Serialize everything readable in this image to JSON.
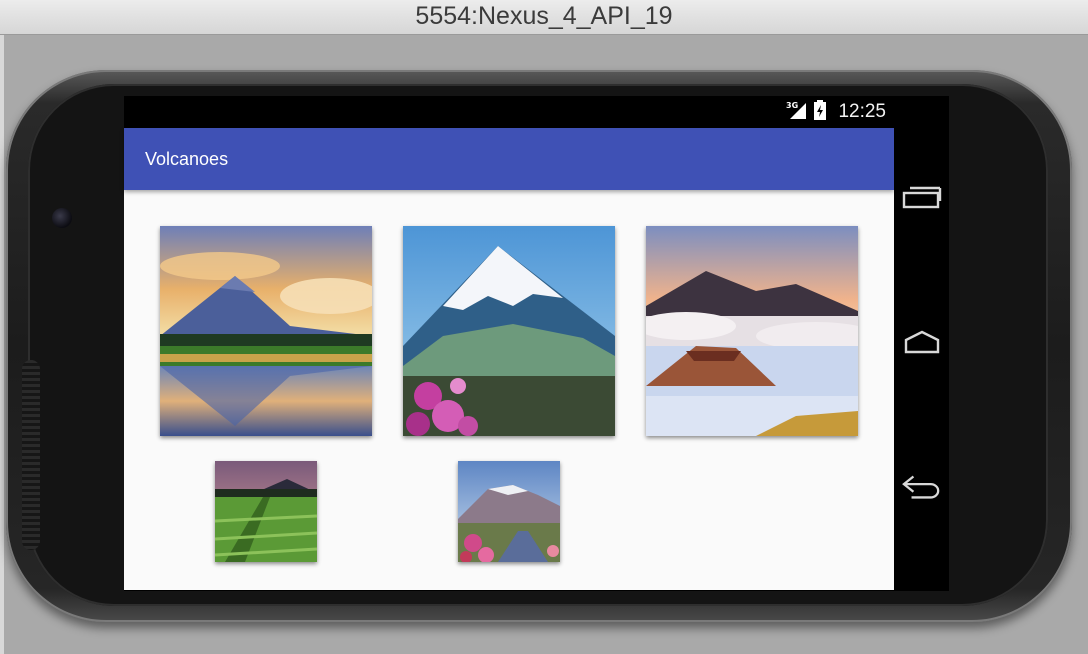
{
  "window": {
    "title": "5554:Nexus_4_API_19"
  },
  "status_bar": {
    "network": "3G",
    "time": "12:25"
  },
  "app": {
    "title": "Volcanoes"
  },
  "gallery": {
    "items": [
      {
        "name": "mayon-volcano-lake"
      },
      {
        "name": "snow-capped-volcano"
      },
      {
        "name": "volcano-above-clouds"
      },
      {
        "name": "volcano-rice-field"
      },
      {
        "name": "volcano-flower-road"
      }
    ]
  },
  "nav": {
    "icons": [
      "recent-apps-icon",
      "home-icon",
      "back-icon"
    ]
  }
}
